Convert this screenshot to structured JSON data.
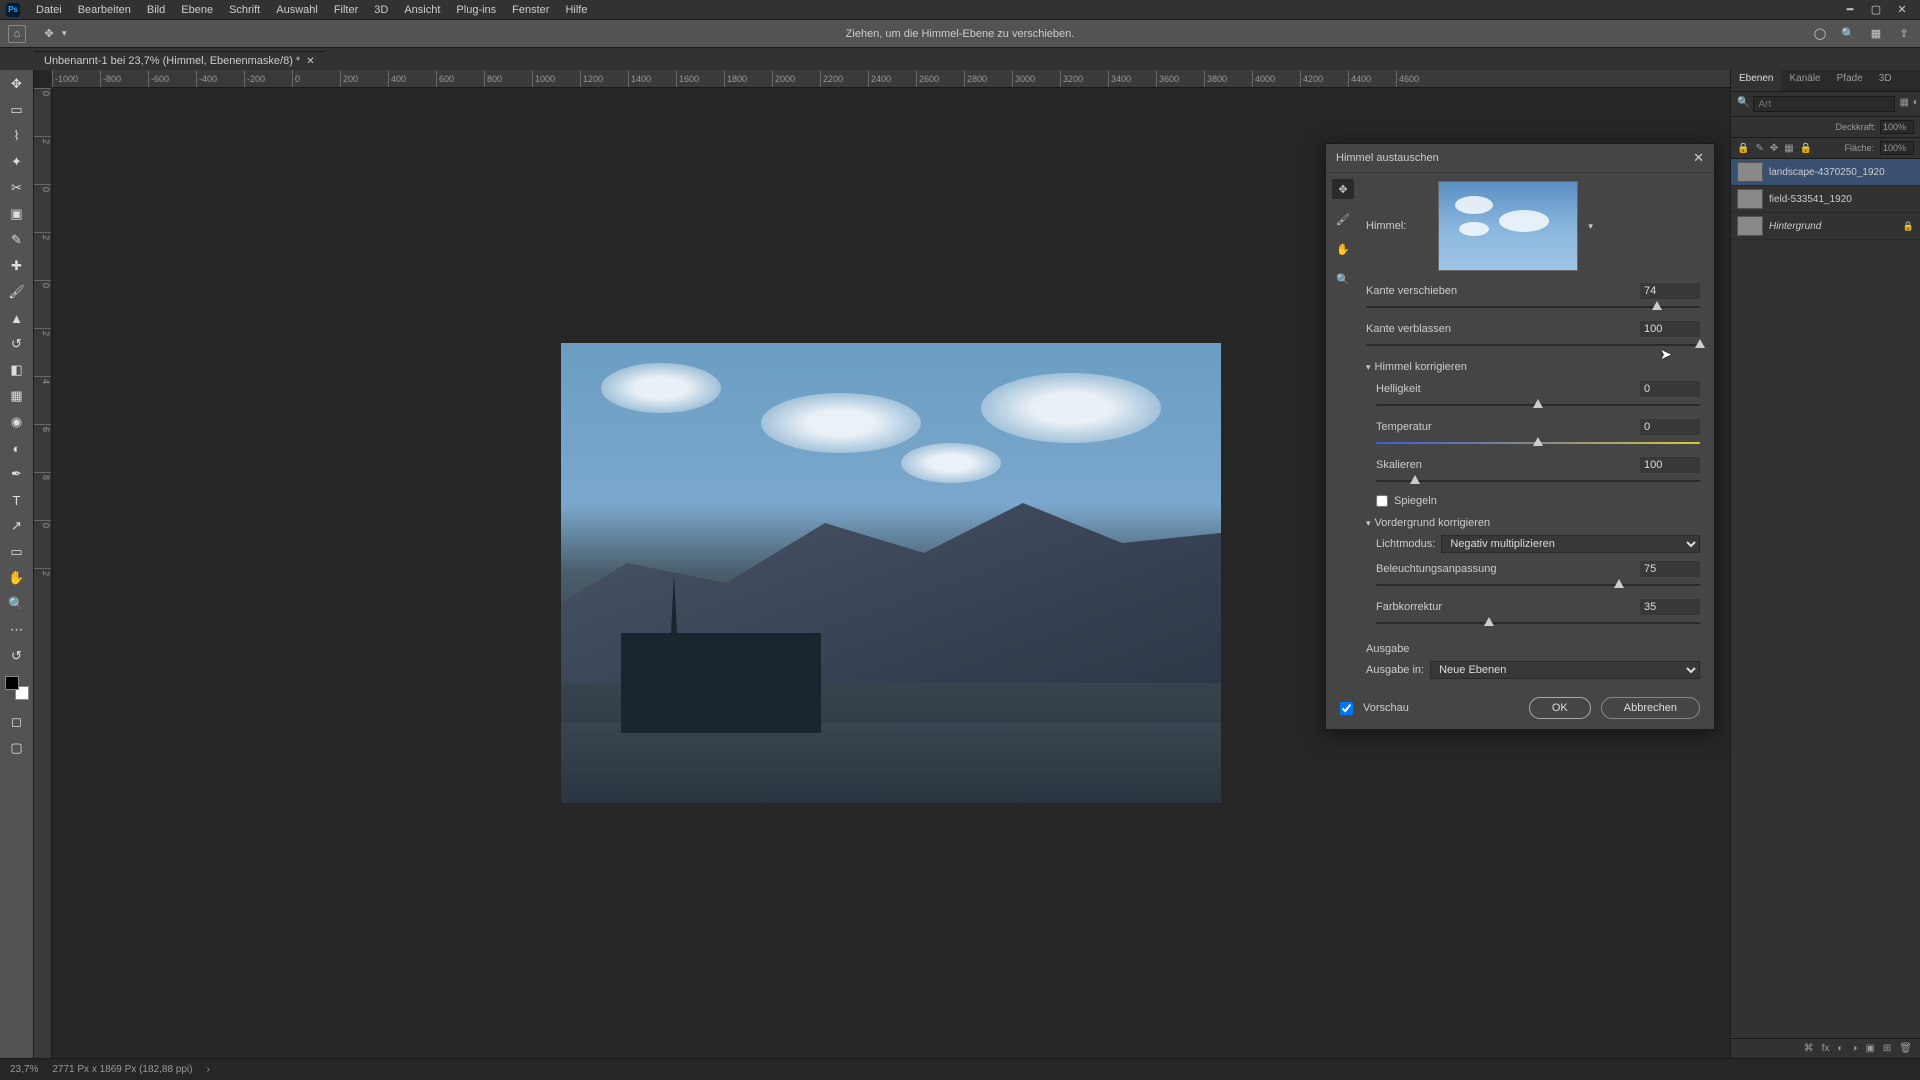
{
  "menu": {
    "items": [
      "Datei",
      "Bearbeiten",
      "Bild",
      "Ebene",
      "Schrift",
      "Auswahl",
      "Filter",
      "3D",
      "Ansicht",
      "Plug-ins",
      "Fenster",
      "Hilfe"
    ]
  },
  "options_hint": "Ziehen, um die Himmel-Ebene zu verschieben.",
  "doc_tab": "Unbenannt-1 bei 23,7% (Himmel, Ebenenmaske/8) *",
  "ruler_h": [
    "-1000",
    "-800",
    "-600",
    "-400",
    "-200",
    "0",
    "200",
    "400",
    "600",
    "800",
    "1000",
    "1200",
    "1400",
    "1600",
    "1800",
    "2000",
    "2200",
    "2400",
    "2600",
    "2800",
    "3000",
    "3200",
    "3400",
    "3600",
    "3800",
    "4000",
    "4200",
    "4400",
    "4600"
  ],
  "ruler_v": [
    "0",
    "2",
    "0",
    "2",
    "0",
    "2",
    "4",
    "6",
    "8",
    "0",
    "2"
  ],
  "dialog": {
    "title": "Himmel austauschen",
    "sky_label": "Himmel:",
    "edge_shift_label": "Kante verschieben",
    "edge_shift_value": "74",
    "edge_fade_label": "Kante verblassen",
    "edge_fade_value": "100",
    "sky_adjust_header": "Himmel korrigieren",
    "brightness_label": "Helligkeit",
    "brightness_value": "0",
    "temperature_label": "Temperatur",
    "temperature_value": "0",
    "scale_label": "Skalieren",
    "scale_value": "100",
    "flip_label": "Spiegeln",
    "fg_header": "Vordergrund korrigieren",
    "light_mode_label": "Lichtmodus:",
    "light_mode_value": "Negativ multiplizieren",
    "lighting_label": "Beleuchtungsanpassung",
    "lighting_value": "75",
    "color_label": "Farbkorrektur",
    "color_value": "35",
    "output_header": "Ausgabe",
    "output_to_label": "Ausgabe in:",
    "output_to_value": "Neue Ebenen",
    "preview_label": "Vorschau",
    "ok_label": "OK",
    "cancel_label": "Abbrechen"
  },
  "panels": {
    "tabs": [
      "Ebenen",
      "Kanäle",
      "Pfade",
      "3D"
    ],
    "search_placeholder": "Art",
    "opacity_label": "Deckkraft:",
    "opacity_value": "100%",
    "fill_label": "Fläche:",
    "fill_value": "100%",
    "layers": [
      {
        "name": "landscape-4370250_1920",
        "sel": true,
        "italic": false
      },
      {
        "name": "field-533541_1920",
        "sel": false,
        "italic": false
      },
      {
        "name": "Hintergrund",
        "sel": false,
        "italic": true,
        "locked": true
      }
    ]
  },
  "status": {
    "zoom": "23,7%",
    "info": "2771 Px x 1869 Px (182,88 ppi)"
  }
}
